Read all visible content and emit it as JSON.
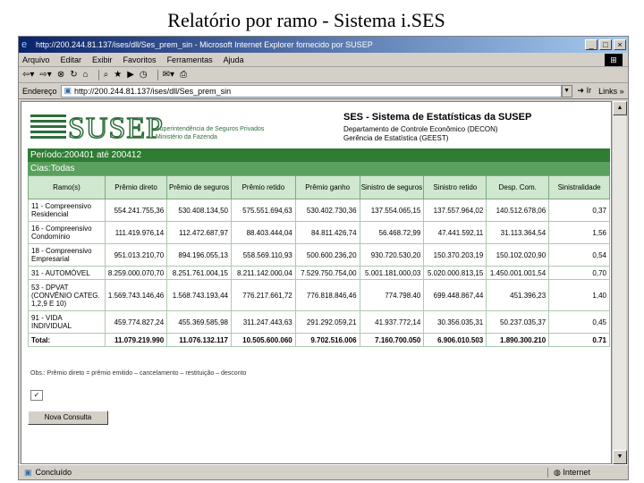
{
  "slide": {
    "title": "Relatório por ramo - Sistema i.SES"
  },
  "window": {
    "title": "http://200.244.81.137/ises/dll/Ses_prem_sin - Microsoft Internet Explorer fornecido por SUSEP",
    "menu": [
      "Arquivo",
      "Editar",
      "Exibir",
      "Favoritos",
      "Ferramentas",
      "Ajuda"
    ],
    "address_label": "Endereço",
    "address": "http://200.244.81.137/ises/dll/Ses_prem_sin",
    "go_label": "Ir",
    "links_label": "Links »",
    "status": "Concluído",
    "zone": "Internet"
  },
  "header": {
    "logo_text": "SUSEP",
    "logo_sub1": "Superintendência de Seguros Privados",
    "logo_sub2": "Ministério da Fazenda",
    "system_title": "SES - Sistema de Estatísticas da SUSEP",
    "dept": "Departamento de Controle Econômico (DECON)",
    "gerencia": "Gerência de Estatística (GEEST)"
  },
  "report": {
    "period": "Período:200401 até 200412",
    "cias": "Cias:Todas",
    "columns": [
      "Ramo(s)",
      "Prêmio direto",
      "Prêmio de seguros",
      "Prêmio retido",
      "Prêmio ganho",
      "Sinistro de seguros",
      "Sinistro retido",
      "Desp. Com.",
      "Sinistralidade"
    ],
    "rows": [
      [
        "11 - Compreensivo Residencial",
        "554.241.755,36",
        "530.408.134,50",
        "575.551.694,63",
        "530.402.730,36",
        "137.554.065,15",
        "137.557.964,02",
        "140.512.678,06",
        "0,37"
      ],
      [
        "16 - Compreensivo Condomínio",
        "111.419.976,14",
        "112.472.687,97",
        "88.403.444,04",
        "84.811.426,74",
        "56.468.72,99",
        "47.441.592,11",
        "31.113.364,54",
        "1,56"
      ],
      [
        "18 - Compreensivo Empresarial",
        "951.013.210,70",
        "894.196.055,13",
        "558.569.110,93",
        "500.600.236,20",
        "930.720.530,20",
        "150.370.203,19",
        "150.102.020,90",
        "0,54"
      ],
      [
        "31 - AUTOMÓVEL",
        "8.259.000.070,70",
        "8.251.761.004,15",
        "8.211.142.000,04",
        "7.529.750.754,00",
        "5.001.181.000,03",
        "5.020.000.813,15",
        "1.450.001.001,54",
        "0,70"
      ],
      [
        "53 - DPVAT (CONVÊNIO CATEG. 1,2,9 E 10)",
        "1.569.743.146,46",
        "1.568.743.193,44",
        "776.217.661,72",
        "776.818.846,46",
        "774.798.40",
        "699.448.867,44",
        "451.396,23",
        "1,40"
      ],
      [
        "91 - VIDA INDIVIDUAL",
        "459.774.827,24",
        "455.369.585,98",
        "311.247.443,63",
        "291.292.059,21",
        "41.937.772,14",
        "30.356.035,31",
        "50.237.035,37",
        "0,45"
      ]
    ],
    "total": [
      "Total:",
      "11.079.219.990",
      "11.076.132.117",
      "10.505.600.060",
      "9.702.516.006",
      "7.160.700.050",
      "6.906.010.503",
      "1.890.300.210",
      "0.71"
    ],
    "footnote": "Obs.: Prêmio direto = prêmio emitido – cancelamento – restituição – desconto",
    "new_query_label": "Nova Consulta"
  }
}
